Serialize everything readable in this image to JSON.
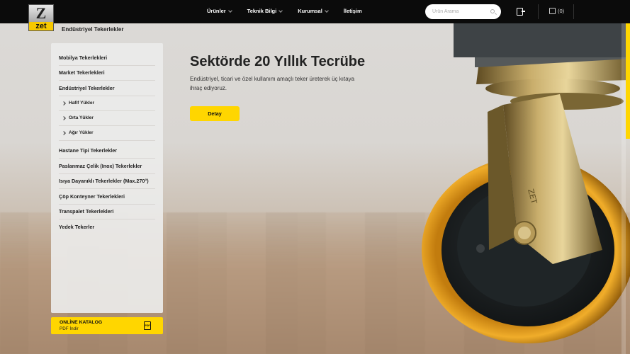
{
  "brand": {
    "logo_z": "Z",
    "logo_text": "zet",
    "tagline": "Endüstriyel Tekerlekler"
  },
  "nav": [
    {
      "label": "Ürünler",
      "has_dropdown": true
    },
    {
      "label": "Teknik Bilgi",
      "has_dropdown": true
    },
    {
      "label": "Kurumsal",
      "has_dropdown": true
    },
    {
      "label": "İletişim",
      "has_dropdown": false
    }
  ],
  "search": {
    "placeholder": "Ürün Arama"
  },
  "cart": {
    "label": "(0)"
  },
  "sidebar": {
    "items": [
      {
        "label": "Mobilya Tekerlekleri",
        "type": "main"
      },
      {
        "label": "Market Tekerlekleri",
        "type": "main"
      },
      {
        "label": "Endüstriyel Tekerlekler",
        "type": "main"
      },
      {
        "label": "Hafif Yükler",
        "type": "sub"
      },
      {
        "label": "Orta Yükler",
        "type": "sub"
      },
      {
        "label": "Ağır Yükler",
        "type": "sub"
      },
      {
        "label": "Hastane Tipi Tekerlekler",
        "type": "main"
      },
      {
        "label": "Paslanmaz Çelik (Inox) Tekerlekler",
        "type": "main"
      },
      {
        "label": "Isıya Dayanıklı Tekerlekler (Max.270°)",
        "type": "main"
      },
      {
        "label": "Çöp Konteyner Tekerlekleri",
        "type": "main"
      },
      {
        "label": "Transpalet Tekerlekleri",
        "type": "main"
      },
      {
        "label": "Yedek Tekerler",
        "type": "main"
      }
    ]
  },
  "catalog": {
    "title": "ONLİNE KATALOG",
    "subtitle": "PDF İndir",
    "icon_label": "PDF"
  },
  "hero": {
    "title": "Sektörde 20 Yıllık Tecrübe",
    "description": "Endüstriyel, ticari ve özel kullanım amaçlı teker üreterek üç kıtaya ihraç ediyoruz.",
    "button_label": "Detay"
  },
  "colors": {
    "accent": "#ffd600",
    "header_bg": "#0b0b0b",
    "wheel_tread": "#e0a21c"
  }
}
